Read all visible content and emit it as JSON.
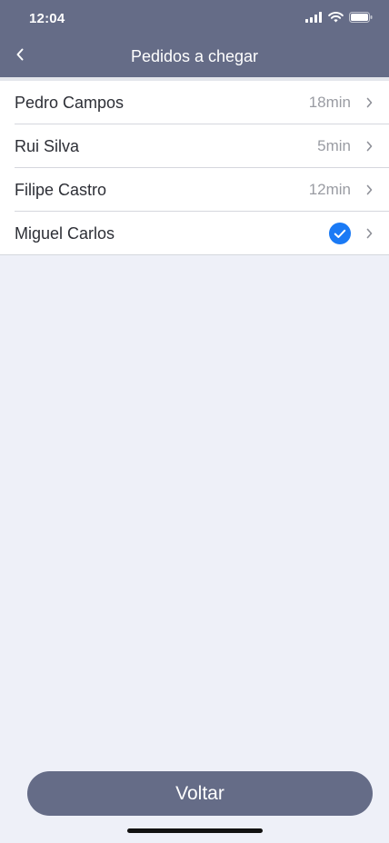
{
  "status_bar": {
    "time": "12:04",
    "icons": [
      "signal-icon",
      "wifi-icon",
      "battery-icon"
    ]
  },
  "nav": {
    "title": "Pedidos a chegar",
    "back_icon": "chevron-left-icon"
  },
  "orders": [
    {
      "name": "Pedro Campos",
      "time": "18min"
    },
    {
      "name": "Rui Silva",
      "time": "5min"
    },
    {
      "name": "Filipe Castro",
      "time": "12min"
    },
    {
      "name": "Miguel Carlos",
      "status": "arrived",
      "status_icon": "check-circle-icon"
    }
  ],
  "footer": {
    "button_label": "Voltar"
  },
  "colors": {
    "header": "#656c87",
    "background": "#eef0f8",
    "check": "#1a7af5",
    "button": "#656c87"
  }
}
